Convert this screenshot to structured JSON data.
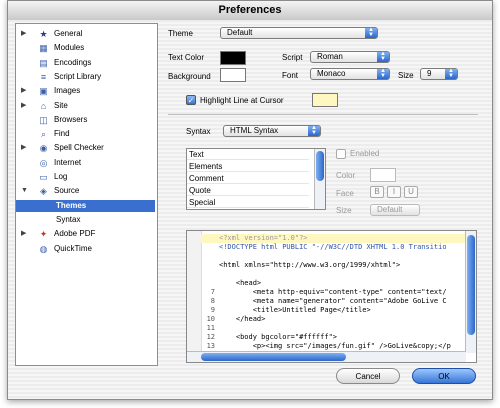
{
  "window": {
    "title": "Preferences"
  },
  "sidebar": {
    "items": [
      {
        "label": "General",
        "icon": "star-icon",
        "expandable": true,
        "selected": false,
        "indent": 0
      },
      {
        "label": "Modules",
        "icon": "modules-icon",
        "expandable": false,
        "selected": false,
        "indent": 0
      },
      {
        "label": "Encodings",
        "icon": "encodings-icon",
        "expandable": false,
        "selected": false,
        "indent": 0
      },
      {
        "label": "Script Library",
        "icon": "script-library-icon",
        "expandable": false,
        "selected": false,
        "indent": 0
      },
      {
        "label": "Images",
        "icon": "images-icon",
        "expandable": true,
        "selected": false,
        "indent": 0
      },
      {
        "label": "Site",
        "icon": "site-icon",
        "expandable": true,
        "selected": false,
        "indent": 0
      },
      {
        "label": "Browsers",
        "icon": "browsers-icon",
        "expandable": false,
        "selected": false,
        "indent": 0
      },
      {
        "label": "Find",
        "icon": "find-icon",
        "expandable": false,
        "selected": false,
        "indent": 0
      },
      {
        "label": "Spell Checker",
        "icon": "spell-checker-icon",
        "expandable": true,
        "selected": false,
        "indent": 0
      },
      {
        "label": "Internet",
        "icon": "internet-icon",
        "expandable": false,
        "selected": false,
        "indent": 0
      },
      {
        "label": "Log",
        "icon": "log-icon",
        "expandable": false,
        "selected": false,
        "indent": 0
      },
      {
        "label": "Source",
        "icon": "source-icon",
        "expandable": true,
        "expanded": true,
        "selected": false,
        "indent": 0
      },
      {
        "label": "Themes",
        "icon": "",
        "expandable": false,
        "selected": true,
        "indent": 1
      },
      {
        "label": "Syntax",
        "icon": "",
        "expandable": false,
        "selected": false,
        "indent": 1
      },
      {
        "label": "Adobe PDF",
        "icon": "pdf-icon",
        "expandable": true,
        "selected": false,
        "indent": 0
      },
      {
        "label": "QuickTime",
        "icon": "quicktime-icon",
        "expandable": false,
        "selected": false,
        "indent": 0
      }
    ]
  },
  "theme": {
    "label": "Theme",
    "value": "Default"
  },
  "text_color": {
    "label": "Text Color",
    "swatch": "#000000"
  },
  "background": {
    "label": "Background",
    "swatch": "#ffffff"
  },
  "script": {
    "label": "Script",
    "value": "Roman"
  },
  "font": {
    "label": "Font",
    "value": "Monaco"
  },
  "size": {
    "label": "Size",
    "value": "9"
  },
  "highlight": {
    "label": "Highlight Line at Cursor",
    "checked": true,
    "swatch": "#fff7c0"
  },
  "syntax": {
    "label": "Syntax",
    "value": "HTML Syntax"
  },
  "syntax_items": [
    "Text",
    "Elements",
    "Comment",
    "Quote",
    "Special"
  ],
  "style_panel": {
    "enabled_label": "Enabled",
    "color_label": "Color",
    "face_label": "Face",
    "face_buttons": [
      "B",
      "I",
      "U"
    ],
    "size_label": "Size",
    "size_value": "Default"
  },
  "code_lines": [
    {
      "n": "",
      "text": "<?xml version=\"1.0\"?>",
      "highlight": true
    },
    {
      "n": "",
      "text": "<!DOCTYPE html PUBLIC \"-//W3C//DTD XHTML 1.0 Transitio",
      "highlight": false
    },
    {
      "n": "",
      "text": "",
      "highlight": false
    },
    {
      "n": "",
      "text": "<html xmlns=\"http://www.w3.org/1999/xhtml\">",
      "highlight": false
    },
    {
      "n": "",
      "text": "",
      "highlight": false
    },
    {
      "n": "",
      "text": "    <head>",
      "highlight": false
    },
    {
      "n": "7",
      "text": "        <meta http-equiv=\"content-type\" content=\"text/",
      "highlight": false
    },
    {
      "n": "8",
      "text": "        <meta name=\"generator\" content=\"Adobe GoLive C",
      "highlight": false
    },
    {
      "n": "9",
      "text": "        <title>Untitled Page</title>",
      "highlight": false
    },
    {
      "n": "10",
      "text": "    </head>",
      "highlight": false
    },
    {
      "n": "11",
      "text": "",
      "highlight": false
    },
    {
      "n": "12",
      "text": "    <body bgcolor=\"#ffffff\">",
      "highlight": false
    },
    {
      "n": "13",
      "text": "        <p><img src=\"/images/fun.gif\" />GoLive&copy;</p",
      "highlight": false
    }
  ],
  "buttons": {
    "cancel": "Cancel",
    "ok": "OK"
  },
  "colors": {
    "accent": "#3a6fd0",
    "popup_arrow": "#2b67c9"
  }
}
